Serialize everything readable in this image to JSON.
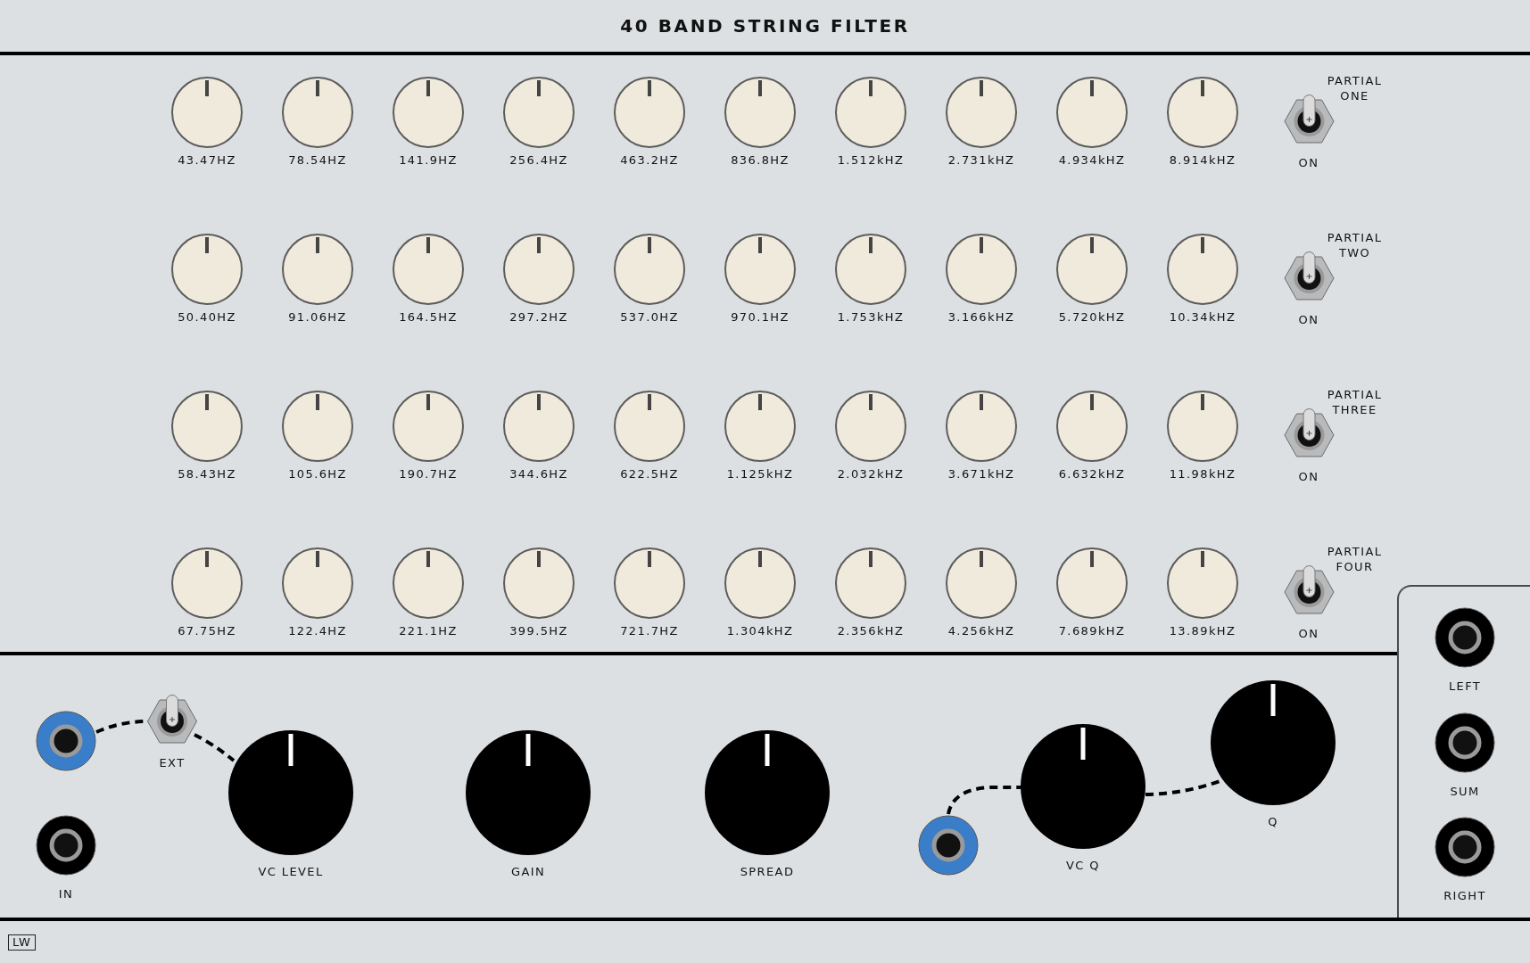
{
  "title": "40 BAND STRING FILTER",
  "partials": [
    {
      "label": "PARTIAL ONE",
      "toggle": {
        "label": "ON",
        "on": true
      },
      "bands": [
        "43.47HZ",
        "78.54HZ",
        "141.9HZ",
        "256.4HZ",
        "463.2HZ",
        "836.8HZ",
        "1.512kHZ",
        "2.731kHZ",
        "4.934kHZ",
        "8.914kHZ"
      ]
    },
    {
      "label": "PARTIAL TWO",
      "toggle": {
        "label": "ON",
        "on": true
      },
      "bands": [
        "50.40HZ",
        "91.06HZ",
        "164.5HZ",
        "297.2HZ",
        "537.0HZ",
        "970.1HZ",
        "1.753kHZ",
        "3.166kHZ",
        "5.720kHZ",
        "10.34kHZ"
      ]
    },
    {
      "label": "PARTIAL THREE",
      "toggle": {
        "label": "ON",
        "on": true
      },
      "bands": [
        "58.43HZ",
        "105.6HZ",
        "190.7HZ",
        "344.6HZ",
        "622.5HZ",
        "1.125kHZ",
        "2.032kHZ",
        "3.671kHZ",
        "6.632kHZ",
        "11.98kHZ"
      ]
    },
    {
      "label": "PARTIAL FOUR",
      "toggle": {
        "label": "ON",
        "on": true
      },
      "bands": [
        "67.75HZ",
        "122.4HZ",
        "221.1HZ",
        "399.5HZ",
        "721.7HZ",
        "1.304kHZ",
        "2.356kHZ",
        "4.256kHZ",
        "7.689kHZ",
        "13.89kHZ"
      ]
    }
  ],
  "controls": [
    {
      "kind": "jack",
      "color": "#3a7dc9"
    },
    {
      "kind": "toggle",
      "label": "EXT",
      "on": true
    },
    {
      "kind": "jack",
      "color": "#000000",
      "label": "IN"
    },
    {
      "kind": "knob",
      "label": "VC LEVEL"
    },
    {
      "kind": "knob",
      "label": "GAIN"
    },
    {
      "kind": "knob",
      "label": "SPREAD"
    },
    {
      "kind": "jack",
      "color": "#3a7dc9"
    },
    {
      "kind": "knob",
      "label": "VC Q"
    },
    {
      "kind": "knob",
      "label": "Q"
    }
  ],
  "outputs": [
    {
      "label": "LEFT"
    },
    {
      "label": "SUM"
    },
    {
      "label": "RIGHT"
    }
  ],
  "logo": "LW"
}
